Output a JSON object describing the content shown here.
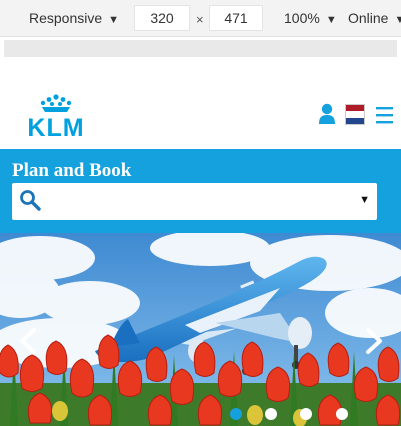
{
  "devtools": {
    "device_label": "Responsive",
    "width_value": "320",
    "times_sign": "×",
    "height_value": "471",
    "zoom_label": "100%",
    "network_label": "Online"
  },
  "site": {
    "logo_text": "KLM",
    "brand_color": "#00a1de",
    "header_icons": [
      "user-icon",
      "netherlands-flag-icon",
      "hamburger-menu-icon"
    ]
  },
  "plan_book": {
    "title": "Plan and Book",
    "panel_color": "#14a1dd",
    "search_value": ""
  },
  "carousel": {
    "slide_count": 4,
    "active_slide": 1
  }
}
